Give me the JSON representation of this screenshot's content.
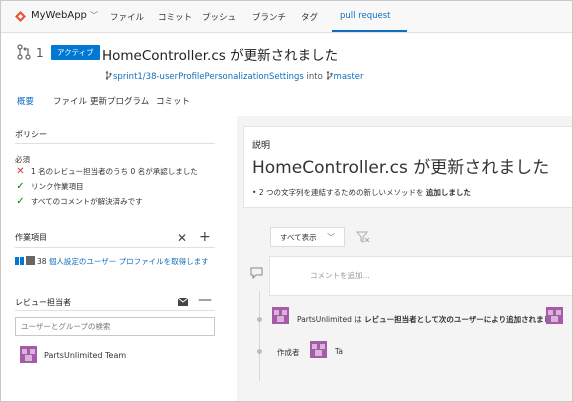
{
  "nav": {
    "app_name": "MyWebApp",
    "items": [
      {
        "label": "ファイル"
      },
      {
        "label": "コミット"
      },
      {
        "label": "プッシュ"
      },
      {
        "label": "ブランチ"
      },
      {
        "label": "タグ"
      },
      {
        "label": "pull request"
      }
    ]
  },
  "pr": {
    "id": "1",
    "status": "アクティブ",
    "title": "HomeController.cs が更新されました",
    "source_branch": "sprint1/38-userProfilePersonalizationSettings",
    "into_text": "into",
    "target_branch": "master"
  },
  "subtabs": [
    {
      "label": "概要"
    },
    {
      "label": "ファイル"
    },
    {
      "label": "更新プログラム"
    },
    {
      "label": "コミット"
    }
  ],
  "policies": {
    "title": "ポリシー",
    "required_label": "必須",
    "items": [
      {
        "text": "1 名のレビュー担当者のうち 0 名が承認しました",
        "mark": "✕"
      },
      {
        "text": "リンク作業項目",
        "mark": "✓"
      },
      {
        "text": "すべてのコメントが解決済みです",
        "mark": "✓"
      }
    ]
  },
  "work_items": {
    "title": "作業項目",
    "item_id": "38",
    "item_title": "個人設定のユーザー プロファイルを取得します"
  },
  "reviewers": {
    "title": "レビュー担当者",
    "search_placeholder": "ユーザーとグループの検索",
    "items": [
      {
        "name": "PartsUnlimited Team"
      }
    ]
  },
  "description": {
    "label": "説明",
    "title": "HomeController.cs が更新されました",
    "bullet_prefix": "2 つの文字列を連結するための新しいメソッドを",
    "bullet_bold": "追加しました"
  },
  "activity": {
    "filter_label": "すべて表示",
    "comment_placeholder": "コメントを追加...",
    "events": [
      {
        "actor": "PartsUnlimited",
        "text_middle": "は",
        "text_bold": "レビュー担当者として次のユーザーにより追加されました"
      },
      {
        "label": "作成者",
        "actor": "Ta"
      }
    ]
  },
  "colors": {
    "accent": "#0078d4",
    "link": "#106ebe",
    "error": "#d13438",
    "success": "#107c10",
    "avatar": "#a55ba8"
  }
}
